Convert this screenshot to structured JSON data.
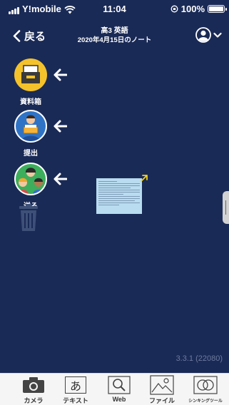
{
  "status_bar": {
    "carrier": "Y!mobile",
    "time": "11:04",
    "battery": "100%"
  },
  "nav": {
    "back_label": "戻る",
    "title": "高3 英語",
    "subtitle": "2020年4月15日のノート"
  },
  "tools": [
    {
      "label": "資料箱"
    },
    {
      "label": "提出"
    },
    {
      "label": "送る"
    }
  ],
  "version": "3.3.1 (22080)",
  "toolbar": [
    {
      "label": "カメラ",
      "icon": "camera-icon"
    },
    {
      "label": "テキスト",
      "icon": "text-icon",
      "glyph": "あ"
    },
    {
      "label": "Web",
      "icon": "web-search-icon"
    },
    {
      "label": "ファイル",
      "icon": "image-file-icon"
    },
    {
      "label": "シンキングツール",
      "icon": "thinking-tool-icon"
    }
  ],
  "colors": {
    "background": "#1a2a56",
    "toolbar": "#f5f5f5",
    "accent_yellow": "#f4c22b",
    "arrow_yellow": "#f2d21a"
  }
}
